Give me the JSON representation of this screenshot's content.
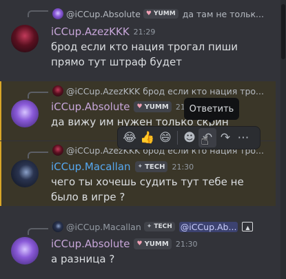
{
  "messages": [
    {
      "reply": {
        "name": "@iCCup.Absolute",
        "tag": "YUMM",
        "text": "да там не тольк..."
      },
      "author": "iCCup.AzezKKK",
      "time": "21:29",
      "text": "брод если кто нация трогал пиши прямо тут штраф будет"
    },
    {
      "reply": {
        "name": "@iCCup.AzezKKK",
        "text": "брод если кто нация тро..."
      },
      "author": "iCCup.Absolute",
      "tag": "YUMM",
      "time": "21:30",
      "text": "да вижу им нужен только скрин"
    },
    {
      "reply": {
        "name": "@iCCup.AzezKKK",
        "text": "брод если кто нация тро..."
      },
      "author": "iCCup.Macallan",
      "tag": "TECH",
      "time": "21:30",
      "text": "чего ты хочешь судить тут тебе не было в игре ?"
    },
    {
      "reply": {
        "name": "@iCCup.Macallan",
        "tag": "TECH",
        "mention": "@iCCup.Ab..."
      },
      "author": "iCCup.Absolute",
      "tag": "YUMM",
      "time": "21:30",
      "text": "а разница ?"
    }
  ],
  "tooltip": "Ответить",
  "toolbar": {
    "icons": [
      "laughing-emoji",
      "thumbs-up-emoji",
      "grinning-emoji",
      "add-reaction",
      "reply",
      "forward",
      "more"
    ]
  },
  "colors": {
    "background": "#323339",
    "highlight": "#3a3628",
    "highlight_border": "#d9a628",
    "name_purple": "#c7a6d9",
    "name_blue": "#56a8f0"
  }
}
